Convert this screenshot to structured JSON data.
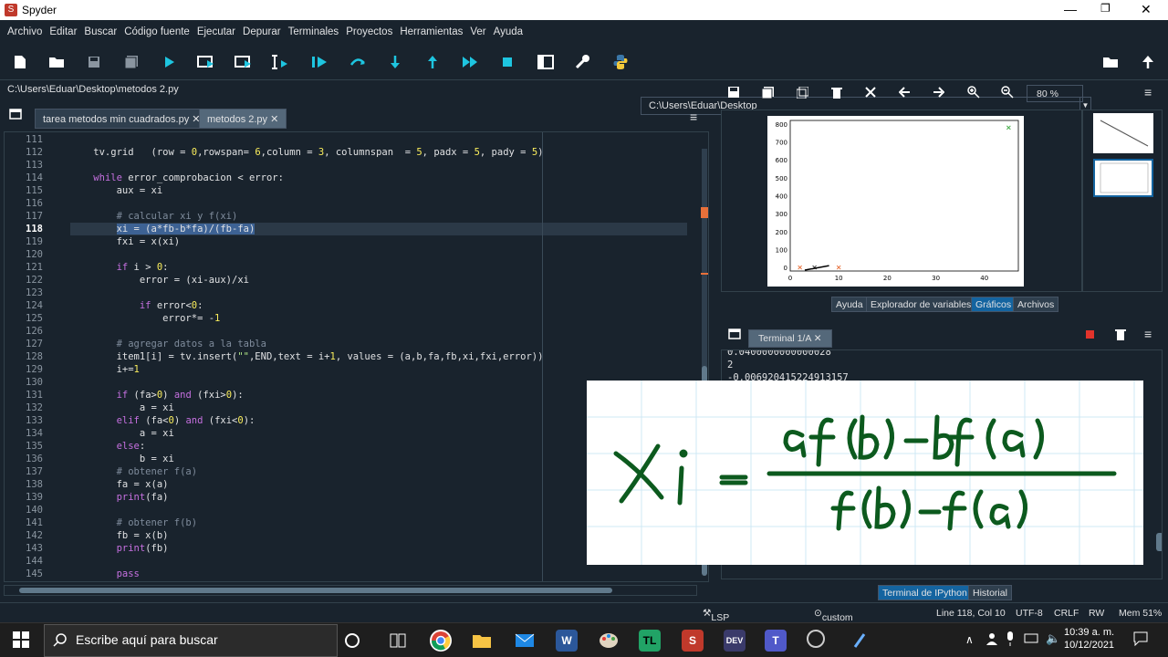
{
  "window": {
    "title": "Spyder",
    "minimize": "—",
    "maximize": "❐",
    "close": "✕"
  },
  "menu": [
    "Archivo",
    "Editar",
    "Buscar",
    "Código fuente",
    "Ejecutar",
    "Depurar",
    "Terminales",
    "Proyectos",
    "Herramientas",
    "Ver",
    "Ayuda"
  ],
  "toolbar": {
    "path": "C:\\Users\\Eduar\\Desktop"
  },
  "editor": {
    "file_path": "C:\\Users\\Eduar\\Desktop\\metodos 2.py",
    "tabs": [
      {
        "label": "tarea metodos min cuadrados.py",
        "close": "✕"
      },
      {
        "label": "metodos 2.py",
        "close": "✕"
      }
    ],
    "line_numbers": [
      "111",
      "112",
      "113",
      "114",
      "115",
      "116",
      "117",
      "118",
      "119",
      "120",
      "121",
      "122",
      "123",
      "124",
      "125",
      "126",
      "127",
      "128",
      "129",
      "130",
      "131",
      "132",
      "133",
      "134",
      "135",
      "136",
      "137",
      "138",
      "139",
      "140",
      "141",
      "142",
      "143",
      "144",
      "145"
    ],
    "current_line": "118"
  },
  "plots": {
    "zoom": "80 %",
    "tabs": [
      "Ayuda",
      "Explorador de variables",
      "Gráficos",
      "Archivos"
    ],
    "y_ticks": [
      "800",
      "700",
      "600",
      "500",
      "400",
      "300",
      "200",
      "100",
      "0"
    ],
    "x_ticks": [
      "0",
      "10",
      "20",
      "30",
      "40"
    ]
  },
  "chart_data": {
    "type": "scatter",
    "x": [
      2,
      10,
      45,
      5
    ],
    "y": [
      0,
      0,
      780,
      0
    ],
    "xlim": [
      0,
      47
    ],
    "ylim": [
      -20,
      820
    ],
    "grid": false,
    "marker_colors": [
      "#e8703a",
      "#e8703a",
      "#4caf50",
      "#333333"
    ]
  },
  "terminal": {
    "tab": "Terminal 1/A",
    "close": "✕",
    "lines": [
      "0.0400000000000028",
      "2",
      "-0.006920415224913157"
    ],
    "tabs": [
      "Terminal de IPython",
      "Historial"
    ]
  },
  "status": {
    "lsp": "LSP Python: listo",
    "env": "custom (Python 3.7.9)",
    "pos": "Line 118, Col 10",
    "enc": "UTF-8",
    "eol": "CRLF",
    "rw": "RW",
    "mem": "Mem 51%"
  },
  "taskbar": {
    "search": "Escribe aquí para buscar",
    "time": "10:39 a. m.",
    "date": "10/12/2021"
  },
  "colors": {
    "accent": "#1464a0",
    "bg": "#19232d",
    "run": "#1ec5e0"
  }
}
